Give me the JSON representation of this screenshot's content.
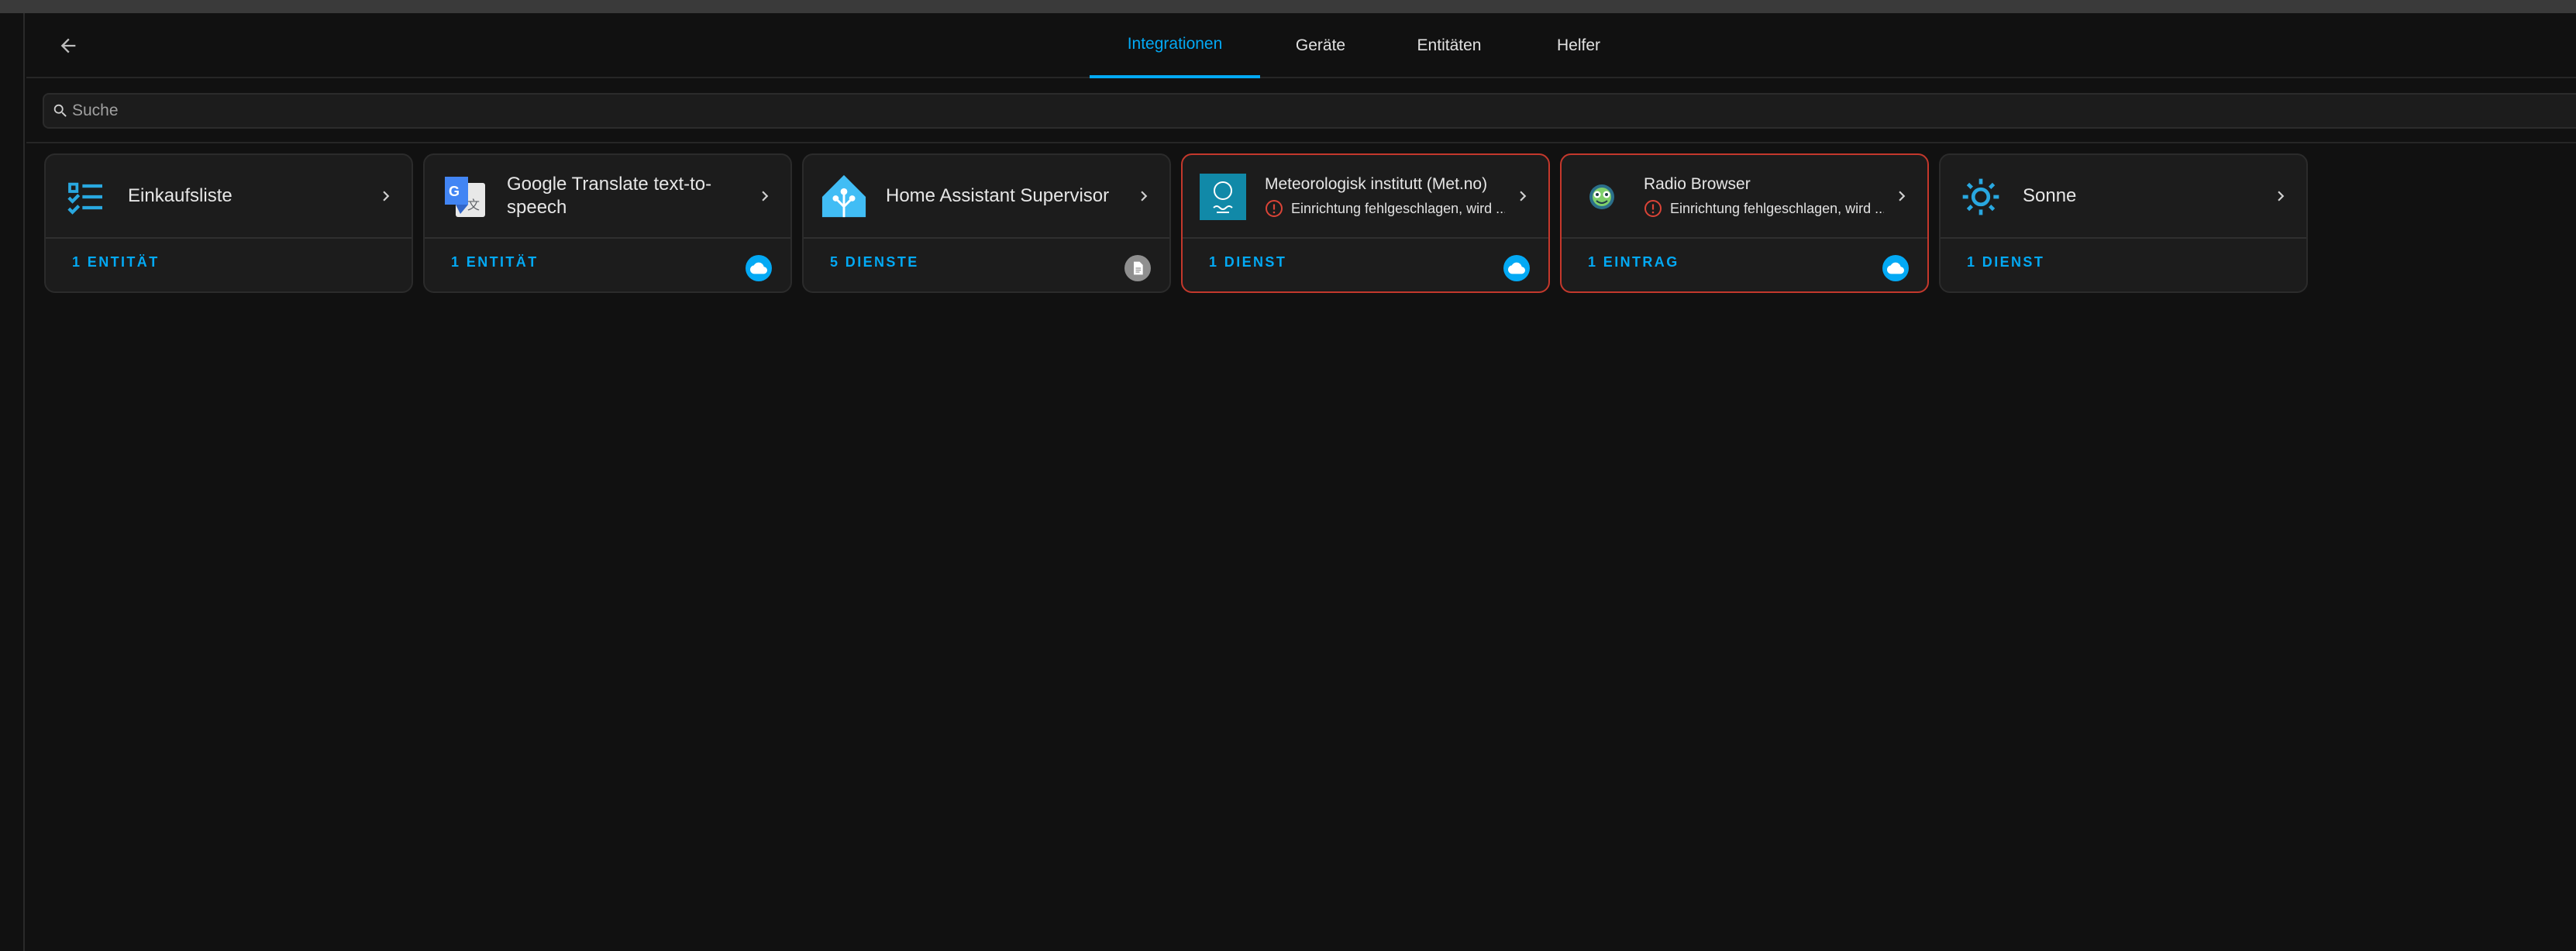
{
  "tabs": [
    {
      "label": "Integrationen",
      "active": true
    },
    {
      "label": "Geräte",
      "active": false
    },
    {
      "label": "Entitäten",
      "active": false
    },
    {
      "label": "Helfer",
      "active": false
    }
  ],
  "search": {
    "placeholder": "Suche",
    "value": ""
  },
  "cards": [
    {
      "title": "Einkaufsliste",
      "icon": "checklist-icon",
      "footer": "1 ENTITÄT",
      "badge": null,
      "error": false
    },
    {
      "title": "Google Translate text-to-speech",
      "icon": "google-translate-icon",
      "footer": "1 ENTITÄT",
      "badge": "cloud-icon",
      "error": false
    },
    {
      "title": "Home Assistant Supervisor",
      "icon": "home-assistant-icon",
      "footer": "5 DIENSTE",
      "badge": "document-icon",
      "error": false
    },
    {
      "title": "Meteorologisk institutt (Met.no)",
      "icon": "met-no-icon",
      "error_text": "Einrichtung fehlgeschlagen, wird ...",
      "footer": "1 DIENST",
      "badge": "cloud-icon",
      "error": true
    },
    {
      "title": "Radio Browser",
      "icon": "radio-browser-icon",
      "error_text": "Einrichtung fehlgeschlagen, wird ...",
      "footer": "1 EINTRAG",
      "badge": "cloud-icon",
      "error": true
    },
    {
      "title": "Sonne",
      "icon": "sun-icon",
      "footer": "1 DIENST",
      "badge": null,
      "error": false
    }
  ],
  "colors": {
    "accent": "#03a9f4",
    "error": "#db4437",
    "background": "#111111",
    "card": "#1c1c1c"
  }
}
